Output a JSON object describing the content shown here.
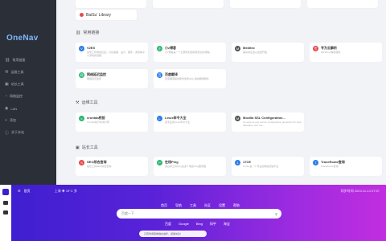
{
  "sidebar": {
    "logo": "OneNav",
    "items": [
      {
        "icon": "link-icon",
        "label": "常用链接"
      },
      {
        "icon": "wrench-icon",
        "label": "运维工具"
      },
      {
        "icon": "box-icon",
        "label": "站长工具"
      },
      {
        "icon": "gauge-icon",
        "label": "网络监控"
      },
      {
        "icon": "wifi-icon",
        "label": "LAN"
      },
      {
        "icon": "plus-icon",
        "label": "添加"
      },
      {
        "icon": "info-icon",
        "label": "关于本站"
      }
    ]
  },
  "top_chips": [
    {
      "label": "BaiSu' Library"
    }
  ],
  "sections": [
    {
      "title": "常用链接",
      "icon": "link-icon"
    },
    {
      "title": "运维工具",
      "icon": "wrench-icon"
    },
    {
      "title": "站长工具",
      "icon": "box-icon"
    }
  ],
  "cards": [
    {
      "title": "V2EX",
      "desc": "创意工作者的社区。讨论编程、设计、硬件、游戏等令人激动的话题。",
      "color": "#2b7de9",
      "letter": "V"
    },
    {
      "title": "小z博客",
      "desc": "小z博客是一个记录原创和转载知识的博客。",
      "color": "#2bb673",
      "letter": "小"
    },
    {
      "title": "Meditec",
      "desc": "美好的生活从这里开始",
      "color": "#555",
      "letter": "M"
    },
    {
      "title": "专为云解析",
      "desc": "DNSPod 解析服务",
      "color": "#e54b4b",
      "letter": "专"
    },
    {
      "title": "网络延迟监控",
      "desc": "网络延迟监控",
      "color": "#2bb673",
      "letter": "网"
    },
    {
      "title": "百度翻译",
      "desc": "百度翻译提供即时免费200+语言翻译服务",
      "color": "#2b7de9",
      "letter": "百"
    },
    {
      "title": "crontab校验",
      "desc": "crontab执行时间计算",
      "color": "#2bb673",
      "letter": "c"
    },
    {
      "title": "Linux命令大全",
      "desc": "最专业的Linux命令大全",
      "color": "#2b7de9",
      "letter": "L"
    },
    {
      "title": "Mozilla SSL Configuration...",
      "desc": "An easy-to-use secure configuration generator for web, database, and ma...",
      "color": "#555",
      "letter": "M"
    },
    {
      "title": "SEO综合查询",
      "desc": "站长工具SEO综合查询",
      "color": "#e54b4b",
      "letter": "S"
    },
    {
      "title": "在线Ping",
      "desc": "通过本工具可以在多个地区Ping服务器",
      "color": "#2bb673",
      "letter": "P"
    },
    {
      "title": "17CE",
      "desc": "17CE 是一个专业的网站测速平台",
      "color": "#2b7de9",
      "letter": "1"
    },
    {
      "title": "TraceRoute查询",
      "desc": "TraceRoute查询",
      "color": "#2b7de9",
      "letter": "T"
    }
  ],
  "bottom": {
    "header_left": "首页",
    "weather": "上海 ☀ 19°C 多",
    "header_right": "同步时间 2023-11-14 07:57",
    "nav": [
      "首页",
      "导航",
      "工具",
      "社区",
      "设置",
      "帮助"
    ],
    "search_placeholder": "百度一下",
    "tabs": [
      "百度",
      "Google",
      "Bing",
      "知乎",
      "淘宝"
    ],
    "notice": "只有时间和体验在进步，感谢关注！"
  }
}
